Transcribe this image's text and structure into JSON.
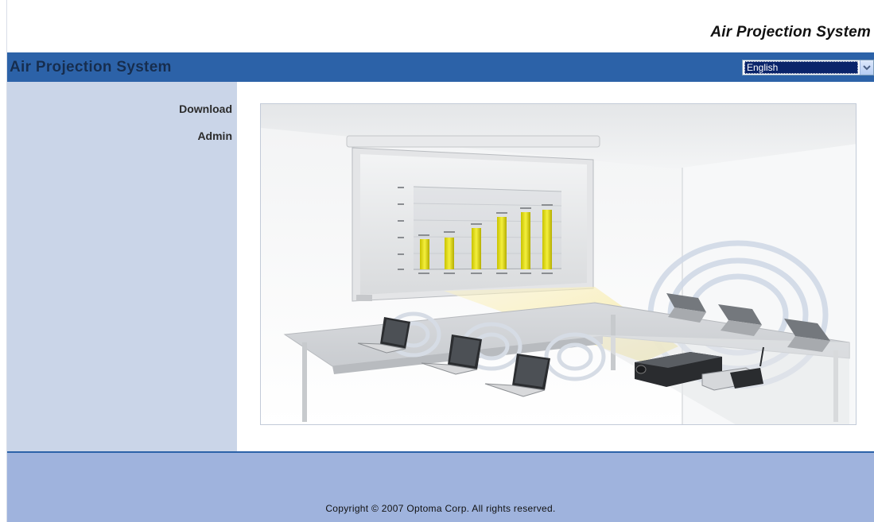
{
  "header": {
    "top_title": "Air Projection System",
    "bar_title": "Air Projection System",
    "language_selected": "English"
  },
  "sidebar": {
    "items": [
      {
        "label": "Download"
      },
      {
        "label": "Admin"
      }
    ]
  },
  "hero": {
    "alt": "Wireless projection classroom illustration"
  },
  "footer": {
    "copyright": "Copyright © 2007 Optoma Corp. All rights reserved."
  },
  "colors": {
    "header_bar": "#2c62a8",
    "sidebar_bg": "#cad5e8",
    "footer_bg": "#9fb3dd",
    "select_highlight": "#0a246a"
  },
  "icons": {
    "dropdown": "chevron-down-icon"
  }
}
